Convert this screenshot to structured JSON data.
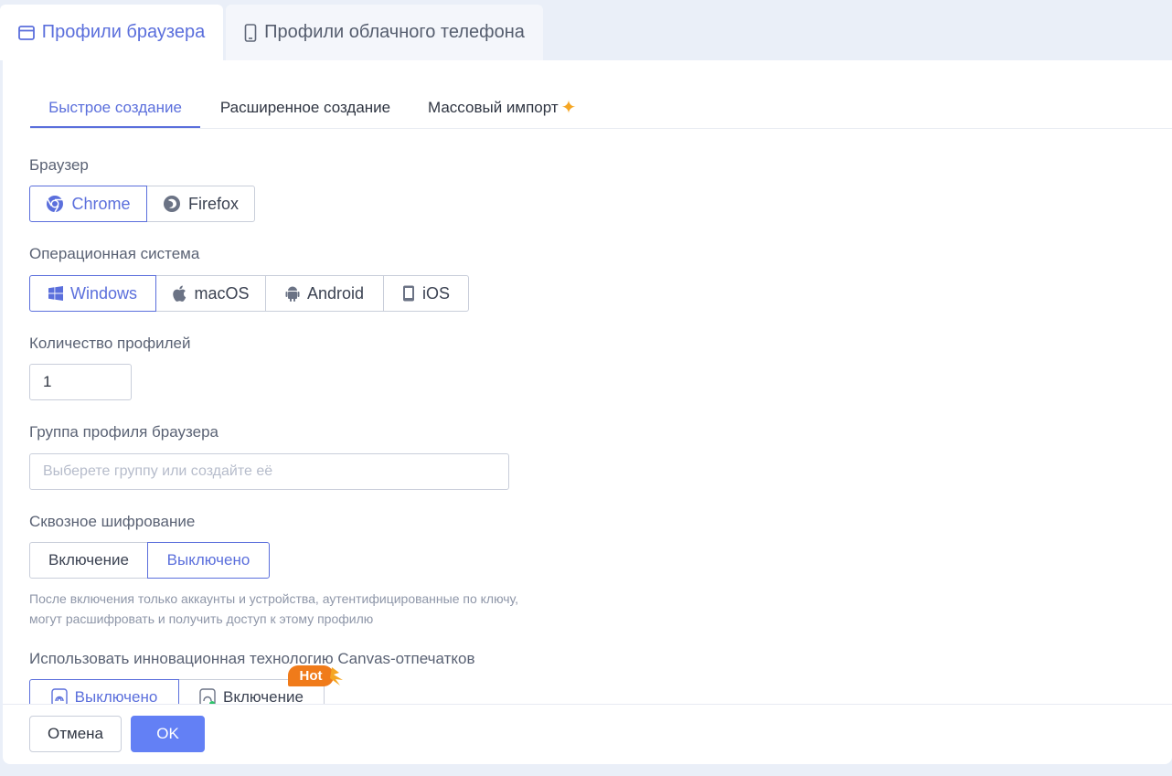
{
  "top_tabs": {
    "browser_profiles": "Профили браузера",
    "cloud_phone_profiles": "Профили облачного телефона"
  },
  "sub_tabs": {
    "quick": "Быстрое создание",
    "advanced": "Расширенное создание",
    "bulk": "Массовый импорт"
  },
  "browser": {
    "label": "Браузер",
    "options": [
      "Chrome",
      "Firefox"
    ],
    "selected": "Chrome"
  },
  "os": {
    "label": "Операционная система",
    "options": [
      "Windows",
      "macOS",
      "Android",
      "iOS"
    ],
    "selected": "Windows"
  },
  "profile_count": {
    "label": "Количество профилей",
    "value": "1"
  },
  "group": {
    "label": "Группа профиля браузера",
    "placeholder": "Выберете группу или создайте её"
  },
  "encryption": {
    "label": "Сквозное шифрование",
    "options": [
      "Включение",
      "Выключено"
    ],
    "selected": "Выключено",
    "hint_line1": "После включения только аккаунты и устройства, аутентифицированные по ключу,",
    "hint_line2": "могут расшифровать и получить доступ к этому профилю"
  },
  "canvas": {
    "label": "Использовать инновационная технологию Canvas-отпечатков",
    "options": [
      "Выключено",
      "Включение"
    ],
    "selected": "Выключено",
    "badge": "Hot"
  },
  "footer": {
    "cancel": "Отмена",
    "ok": "OK"
  },
  "colors": {
    "accent": "#5b6fdc",
    "primary_button": "#6380f5",
    "hot_badge": "#f07b1a",
    "star": "#f5a623"
  }
}
